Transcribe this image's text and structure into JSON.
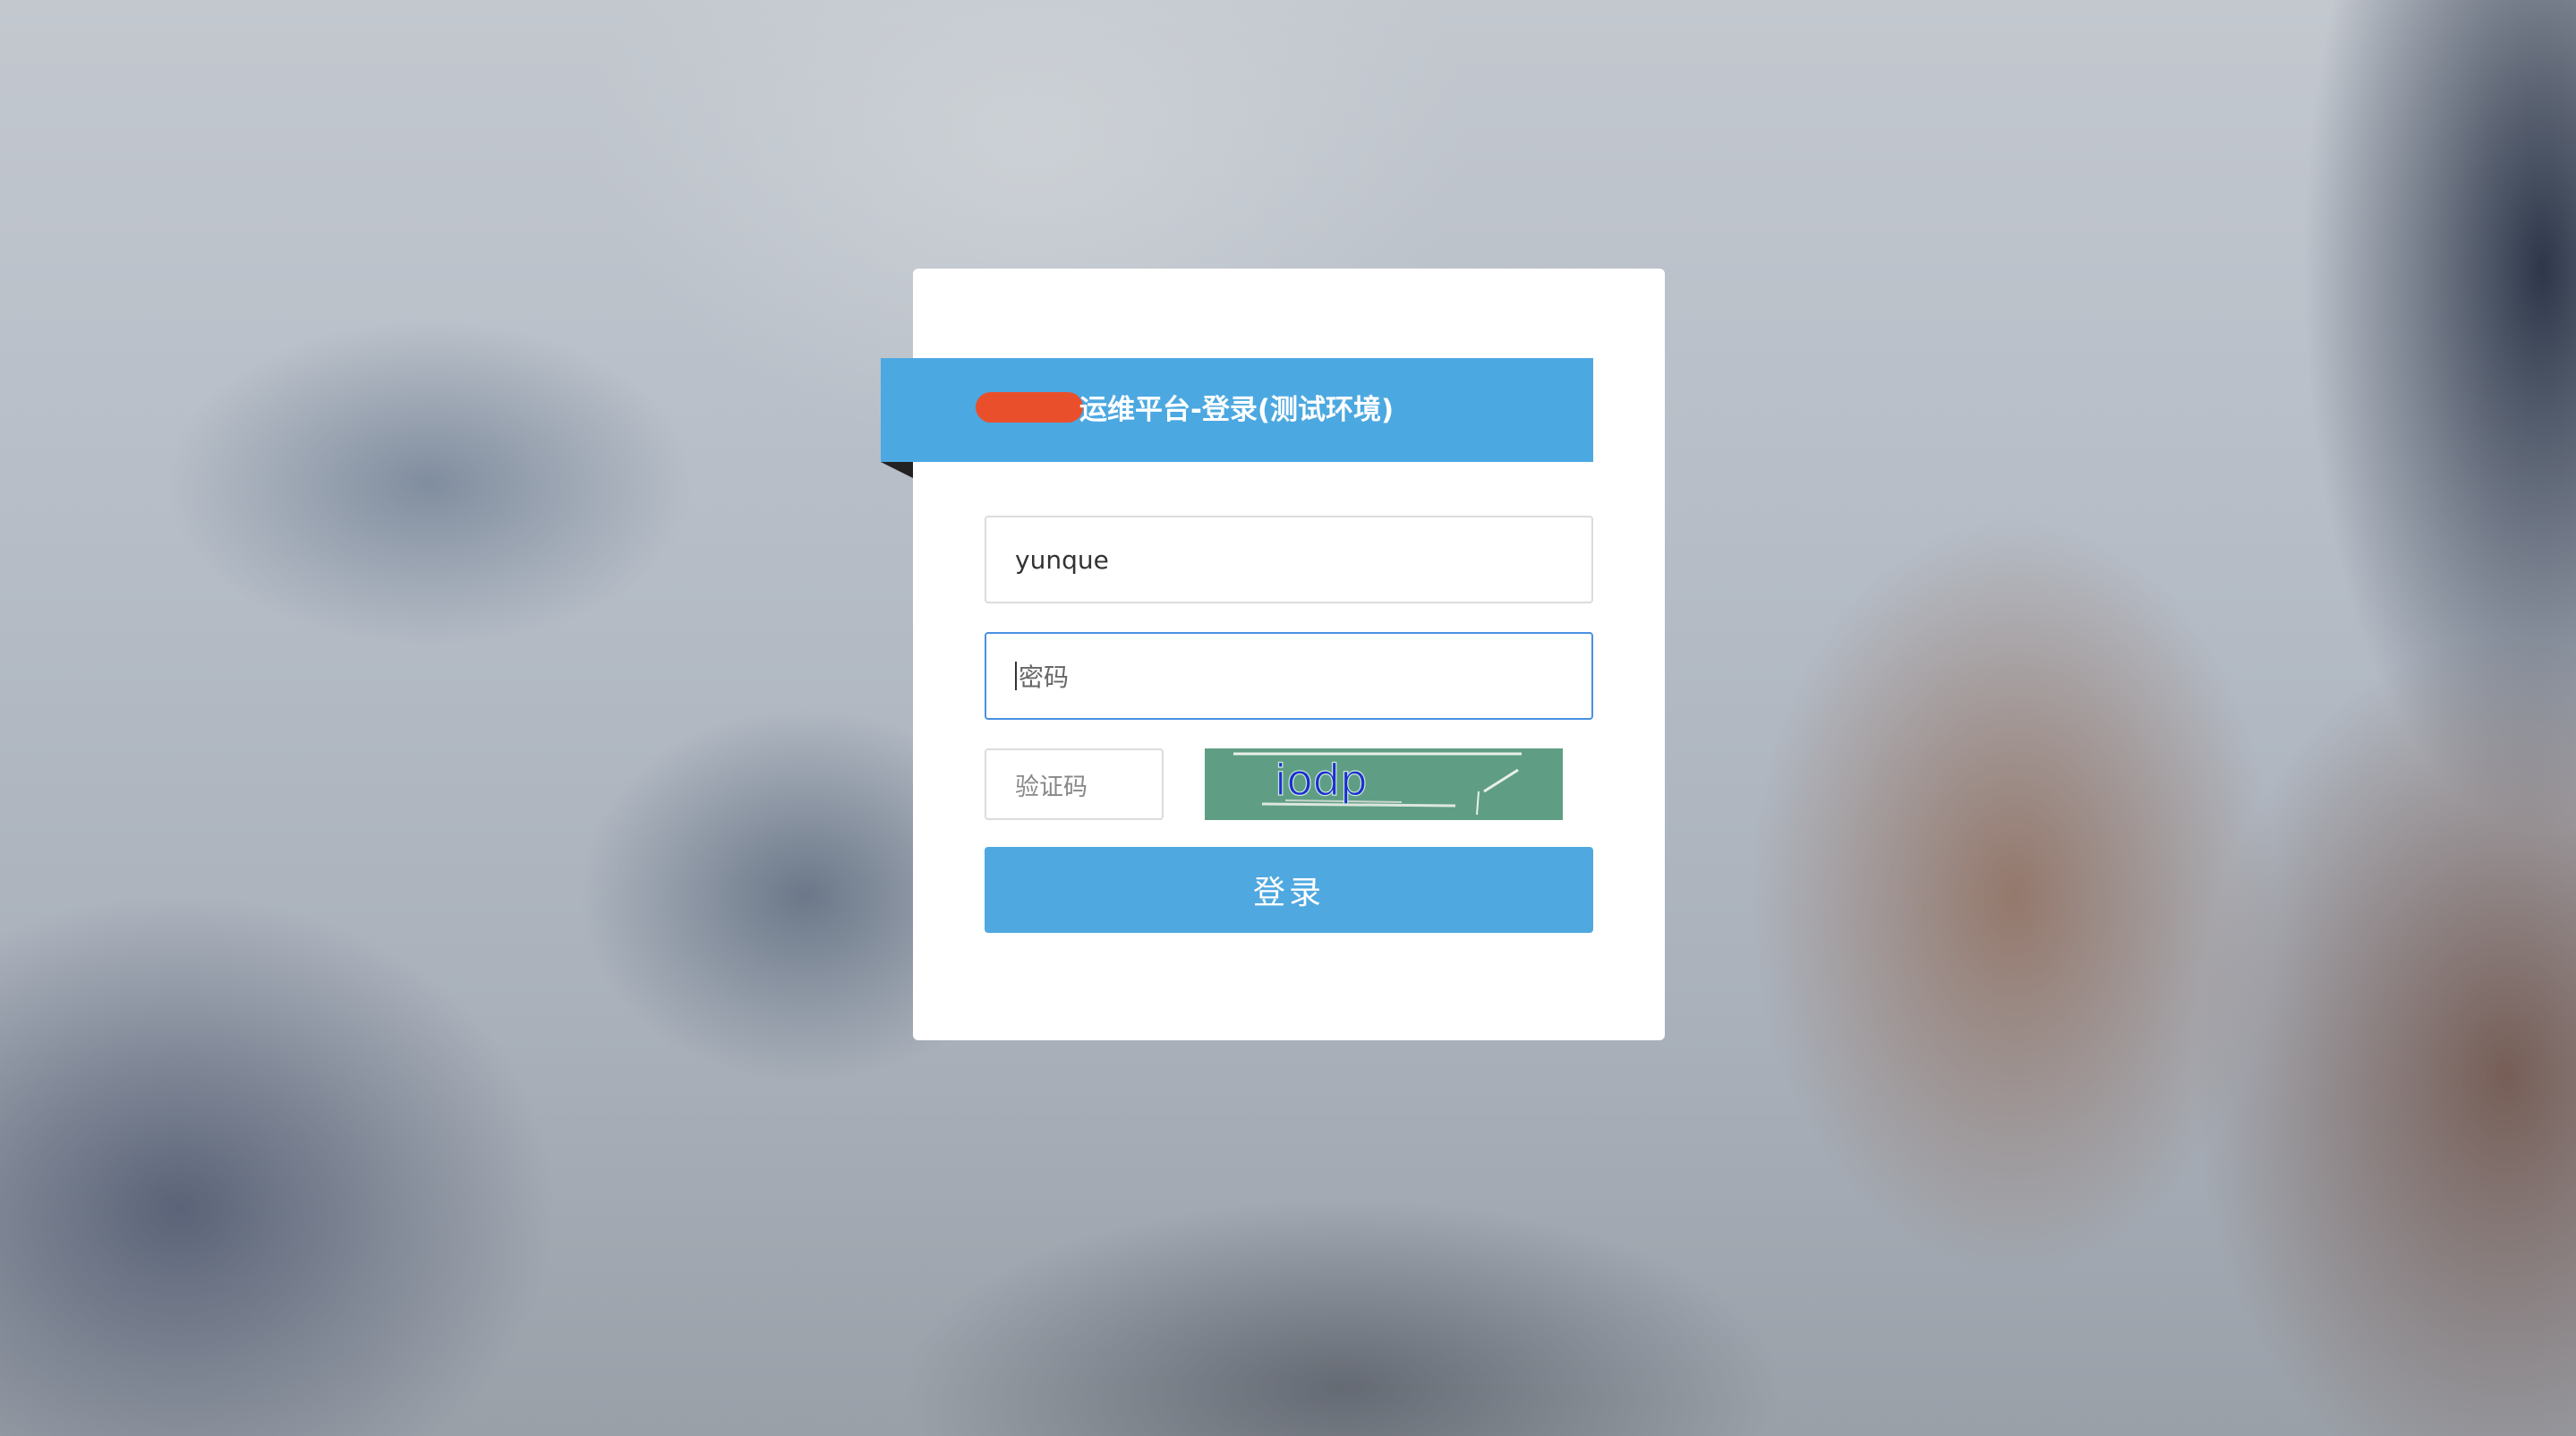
{
  "ribbon": {
    "title": "运维平台-登录(测试环境)"
  },
  "form": {
    "username_value": "yunque",
    "password_placeholder": "密码",
    "captcha_placeholder": "验证码",
    "captcha_text": "iodp",
    "login_label": "登录"
  },
  "colors": {
    "ribbon": "#4ca8e0",
    "button": "#4fa8df",
    "redaction": "#ea4f2c",
    "focus_border": "#4a90e2",
    "captcha_bg": "#5f9e84",
    "captcha_text": "#1a2fd0"
  }
}
